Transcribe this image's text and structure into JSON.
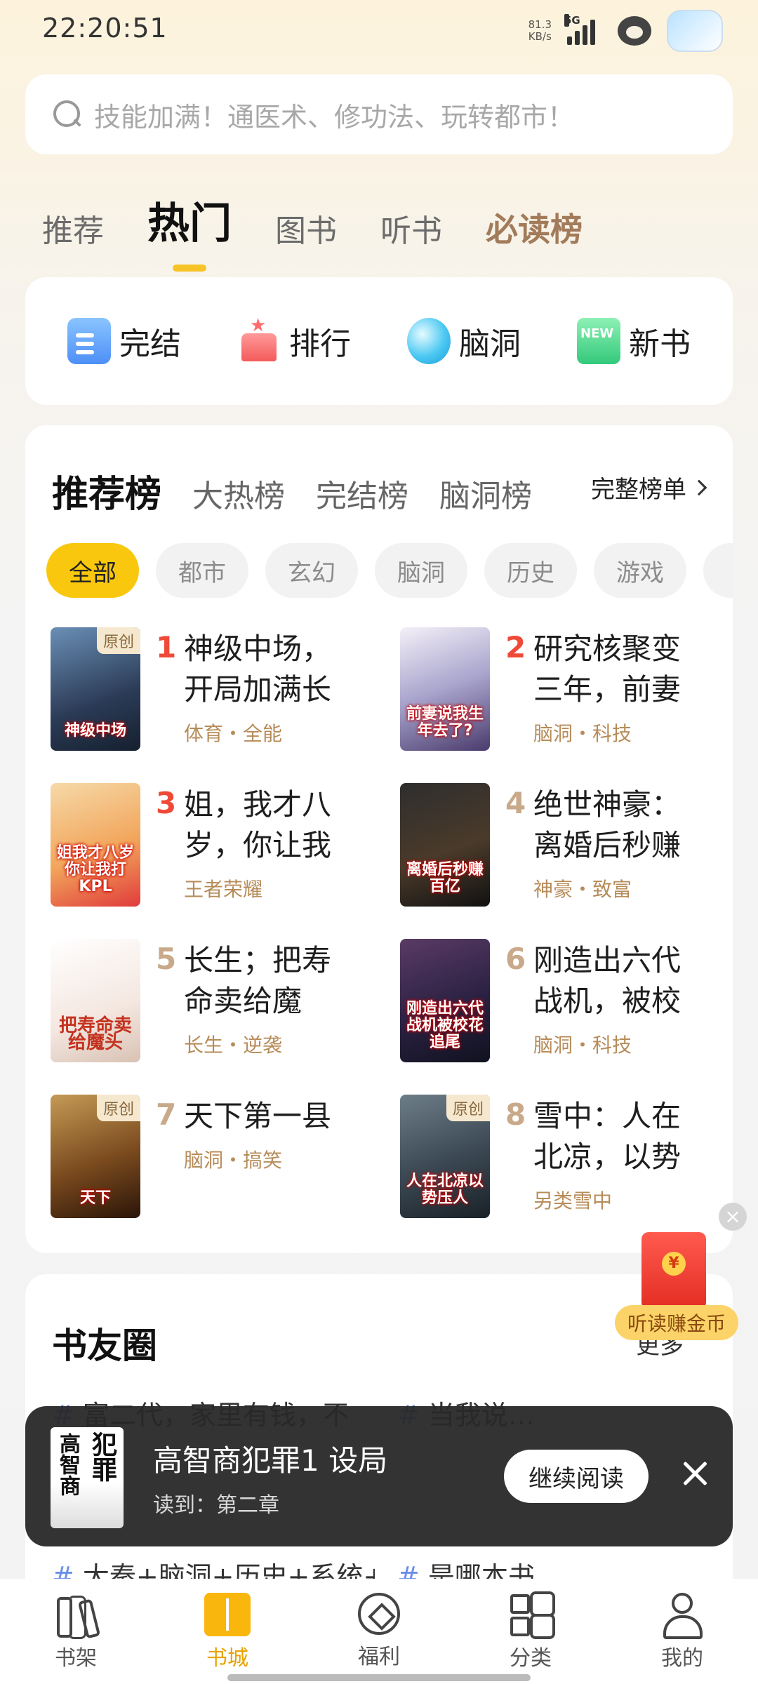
{
  "status_bar": {
    "time": "22:20:51",
    "net_speed_value": "81.3",
    "net_speed_unit": "KB/s",
    "network": "5G"
  },
  "search": {
    "placeholder": "技能加满！通医术、修功法、玩转都市！"
  },
  "top_tabs": [
    {
      "label": "推荐"
    },
    {
      "label": "热门"
    },
    {
      "label": "图书"
    },
    {
      "label": "听书"
    },
    {
      "label": "必读榜"
    }
  ],
  "quick_entries": [
    {
      "label": "完结",
      "icon": "document-icon"
    },
    {
      "label": "排行",
      "icon": "ranking-icon"
    },
    {
      "label": "脑洞",
      "icon": "crystal-ball-icon"
    },
    {
      "label": "新书",
      "icon": "new-badge-icon"
    }
  ],
  "ranking": {
    "tabs": [
      "推荐榜",
      "大热榜",
      "完结榜",
      "脑洞榜"
    ],
    "full_list_label": "完整榜单",
    "chips": [
      "全部",
      "都市",
      "玄幻",
      "脑洞",
      "历史",
      "游戏"
    ],
    "books": [
      {
        "rank": "1",
        "title": "神级中场，开局加满长",
        "tags": "体育・全能",
        "badge": "原创",
        "cover_text": "神级中场"
      },
      {
        "rank": "2",
        "title": "研究核聚变三年，前妻",
        "tags": "脑洞・科技",
        "badge": "",
        "cover_text": "前妻说我生年去了?"
      },
      {
        "rank": "3",
        "title": "姐，我才八岁，你让我",
        "tags": "王者荣耀",
        "badge": "",
        "cover_text": "姐我才八岁你让我打KPL"
      },
      {
        "rank": "4",
        "title": "绝世神豪：离婚后秒赚",
        "tags": "神豪・致富",
        "badge": "",
        "cover_text": "离婚后秒赚百亿"
      },
      {
        "rank": "5",
        "title": "长生；把寿命卖给魔",
        "tags": "长生・逆袭",
        "badge": "",
        "cover_text": "把寿命卖给魔头"
      },
      {
        "rank": "6",
        "title": "刚造出六代战机，被校",
        "tags": "脑洞・科技",
        "badge": "",
        "cover_text": "刚造出六代战机被校花追尾"
      },
      {
        "rank": "7",
        "title": "天下第一县",
        "tags": "脑洞・搞笑",
        "badge": "原创",
        "cover_text": "天下"
      },
      {
        "rank": "8",
        "title": "雪中：人在北凉，以势",
        "tags": "另类雪中",
        "badge": "原创",
        "cover_text": "人在北凉以势压人"
      }
    ]
  },
  "friends_circle": {
    "title": "书友圈",
    "more_label": "更多",
    "topics": [
      "富二代，家里有钱，不扮猪…",
      "当我说…",
      "大秦+脑洞+历史+系统+九…",
      "是哪本书"
    ]
  },
  "reward": {
    "label": "听读赚金币",
    "close": "×"
  },
  "continue_reading": {
    "title": "高智商犯罪1 设局",
    "progress": "读到：第二章",
    "button": "继续阅读",
    "cover_text_a": "高智商",
    "cover_text_b": "犯罪"
  },
  "bottom_nav": [
    {
      "label": "书架"
    },
    {
      "label": "书城"
    },
    {
      "label": "福利"
    },
    {
      "label": "分类"
    },
    {
      "label": "我的"
    }
  ],
  "colors": {
    "accent": "#f9c80e",
    "rank_top": "#ef4a37",
    "tag_brown": "#b78c5a"
  }
}
